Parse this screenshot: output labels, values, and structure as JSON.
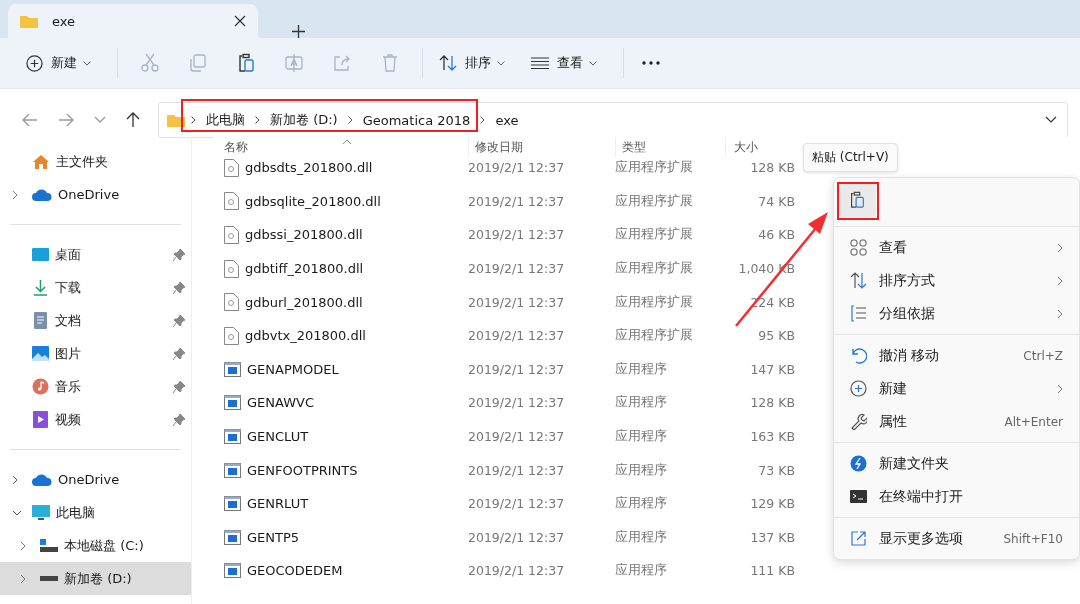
{
  "tab": {
    "title": "exe"
  },
  "toolbar": {
    "new": "新建",
    "tools": [
      {
        "disabled": true
      },
      {
        "disabled": true
      },
      {
        "disabled": false
      },
      {
        "disabled": true
      },
      {
        "disabled": true
      },
      {
        "disabled": true
      }
    ],
    "sort": "排序",
    "view": "查看"
  },
  "address": {
    "crumbs": [
      "此电脑",
      "新加卷 (D:)",
      "Geomatica 2018",
      "exe"
    ]
  },
  "sidebar": {
    "quick": [
      {
        "label": "主文件夹",
        "expandable": false,
        "selected": false
      },
      {
        "label": "OneDrive",
        "expandable": true,
        "selected": false
      }
    ],
    "pinned": [
      {
        "label": "桌面",
        "selected": false
      },
      {
        "label": "下载",
        "selected": false
      },
      {
        "label": "文档",
        "selected": false
      },
      {
        "label": "图片",
        "selected": false
      },
      {
        "label": "音乐",
        "selected": false
      },
      {
        "label": "视频",
        "selected": false
      }
    ],
    "tree": [
      {
        "label": "OneDrive",
        "expanded": false,
        "selected": false
      },
      {
        "label": "此电脑",
        "expanded": true,
        "selected": false,
        "children": [
          {
            "label": "本地磁盘 (C:)",
            "expanded": false,
            "selected": false
          },
          {
            "label": "新加卷 (D:)",
            "expanded": false,
            "selected": true
          }
        ]
      }
    ]
  },
  "table": {
    "columns": [
      "名称",
      "修改日期",
      "类型",
      "大小"
    ],
    "rows": [
      {
        "kind": "dll",
        "name": "gdbsdts_201800.dll",
        "date": "2019/2/1 12:37",
        "type": "应用程序扩展",
        "size": "128 KB"
      },
      {
        "kind": "dll",
        "name": "gdbsqlite_201800.dll",
        "date": "2019/2/1 12:37",
        "type": "应用程序扩展",
        "size": "74 KB"
      },
      {
        "kind": "dll",
        "name": "gdbssi_201800.dll",
        "date": "2019/2/1 12:37",
        "type": "应用程序扩展",
        "size": "46 KB"
      },
      {
        "kind": "dll",
        "name": "gdbtiff_201800.dll",
        "date": "2019/2/1 12:37",
        "type": "应用程序扩展",
        "size": "1,040 KB"
      },
      {
        "kind": "dll",
        "name": "gdburl_201800.dll",
        "date": "2019/2/1 12:37",
        "type": "应用程序扩展",
        "size": "224 KB"
      },
      {
        "kind": "dll",
        "name": "gdbvtx_201800.dll",
        "date": "2019/2/1 12:37",
        "type": "应用程序扩展",
        "size": "95 KB"
      },
      {
        "kind": "exe",
        "name": "GENAPMODEL",
        "date": "2019/2/1 12:37",
        "type": "应用程序",
        "size": "147 KB"
      },
      {
        "kind": "exe",
        "name": "GENAWVC",
        "date": "2019/2/1 12:37",
        "type": "应用程序",
        "size": "128 KB"
      },
      {
        "kind": "exe",
        "name": "GENCLUT",
        "date": "2019/2/1 12:37",
        "type": "应用程序",
        "size": "163 KB"
      },
      {
        "kind": "exe",
        "name": "GENFOOTPRINTS",
        "date": "2019/2/1 12:37",
        "type": "应用程序",
        "size": "73 KB"
      },
      {
        "kind": "exe",
        "name": "GENRLUT",
        "date": "2019/2/1 12:37",
        "type": "应用程序",
        "size": "129 KB"
      },
      {
        "kind": "exe",
        "name": "GENTP5",
        "date": "2019/2/1 12:37",
        "type": "应用程序",
        "size": "137 KB"
      },
      {
        "kind": "exe",
        "name": "GEOCODEDEM",
        "date": "2019/2/1 12:37",
        "type": "应用程序",
        "size": "111 KB"
      }
    ]
  },
  "tooltip": "粘贴 (Ctrl+V)",
  "context_menu": {
    "paste_selected": true,
    "groups": [
      [
        {
          "label": "查看",
          "submenu": true
        },
        {
          "label": "排序方式",
          "submenu": true
        },
        {
          "label": "分组依据",
          "submenu": true
        }
      ],
      [
        {
          "label": "撤消 移动",
          "shortcut": "Ctrl+Z",
          "submenu": false
        },
        {
          "label": "新建",
          "submenu": true
        },
        {
          "label": "属性",
          "shortcut": "Alt+Enter",
          "submenu": false
        }
      ],
      [
        {
          "label": "新建文件夹",
          "submenu": false
        },
        {
          "label": "在终端中打开",
          "submenu": false
        }
      ],
      [
        {
          "label": "显示更多选项",
          "shortcut": "Shift+F10",
          "submenu": false
        }
      ]
    ]
  }
}
